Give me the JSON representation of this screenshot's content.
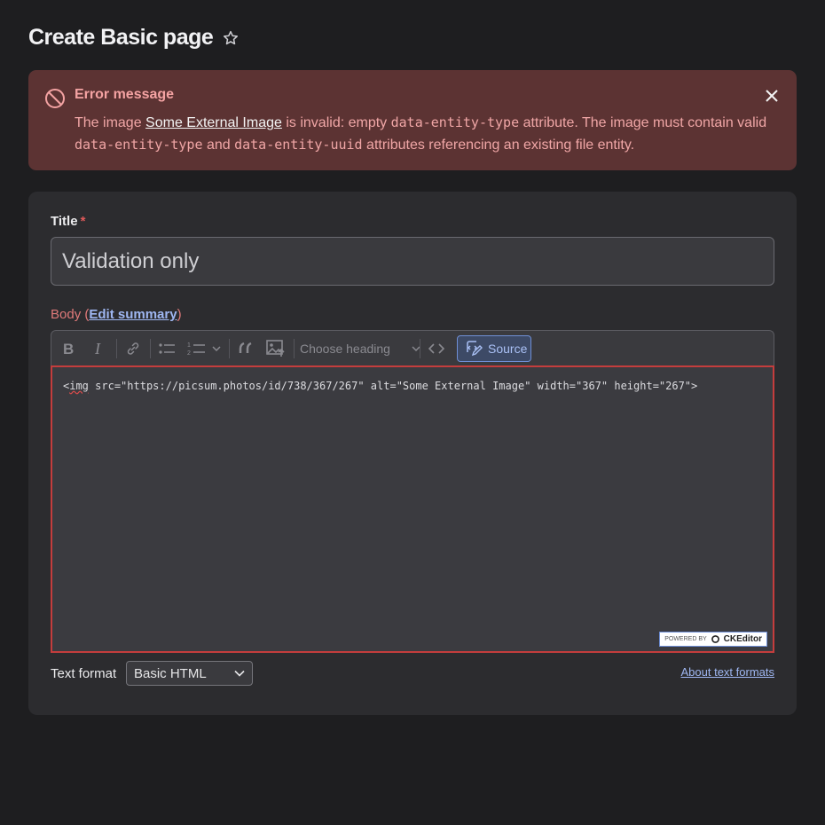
{
  "page": {
    "title": "Create Basic page"
  },
  "error": {
    "heading": "Error message",
    "text_1": "The image ",
    "link": "Some External Image",
    "text_2": " is invalid: empty ",
    "code_1": "data-entity-type",
    "text_3": " attribute. The image must contain valid ",
    "code_2": "data-entity-type",
    "text_4": " and ",
    "code_3": "data-entity-uuid",
    "text_5": " attributes referencing an existing file entity."
  },
  "form": {
    "title_label": "Title",
    "required_mark": "*",
    "title_value": "Validation only",
    "body_label_prefix": "Body (",
    "edit_summary": "Edit summary",
    "body_label_suffix": ")",
    "toolbar": {
      "heading_placeholder": "Choose heading",
      "source_label": "Source"
    },
    "editor": {
      "code_open": "<",
      "code_tag": "img",
      "code_rest": " src=\"https://picsum.photos/id/738/367/267\" alt=\"Some External Image\" width=\"367\" height=\"267\">"
    },
    "powered_by": "POWERED BY",
    "powered_brand": "CKEditor",
    "text_format_label": "Text format",
    "text_format_value": "Basic HTML",
    "about_formats": "About text formats"
  },
  "colors": {
    "error_bg": "#5c3333",
    "accent": "#6f8fd6",
    "invalid_border": "#c43d3d"
  }
}
